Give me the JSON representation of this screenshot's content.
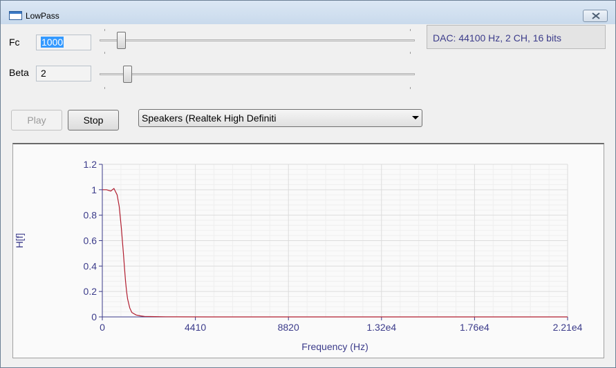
{
  "window": {
    "title": "LowPass"
  },
  "controls": {
    "fc": {
      "label": "Fc",
      "value": "1000",
      "slider_fraction": 0.05
    },
    "beta": {
      "label": "Beta",
      "value": "2",
      "slider_fraction": 0.07
    },
    "dac_status": "DAC: 44100 Hz, 2 CH, 16 bits",
    "play_label": "Play",
    "stop_label": "Stop",
    "device_selected": "Speakers (Realtek High Definiti"
  },
  "colors": {
    "curve": "#b01c2e",
    "axis_text": "#3b3b8a"
  },
  "chart_data": {
    "type": "line",
    "xlabel": "Frequency (Hz)",
    "ylabel": "H[f]",
    "xlim": [
      0,
      22050
    ],
    "ylim": [
      0,
      1.2
    ],
    "x_ticks": [
      0,
      4410,
      8820,
      13230,
      17640,
      22050
    ],
    "x_tick_labels": [
      "0",
      "4410",
      "8820",
      "1.32e4",
      "1.76e4",
      "2.21e4"
    ],
    "y_ticks": [
      0,
      0.2,
      0.4,
      0.6,
      0.8,
      1,
      1.2
    ],
    "y_tick_labels": [
      "0",
      "0.2",
      "0.4",
      "0.6",
      "0.8",
      "1",
      "1.2"
    ],
    "grid": true,
    "series": [
      {
        "x": [
          0,
          200,
          400,
          550,
          700,
          800,
          900,
          950,
          1000,
          1050,
          1100,
          1150,
          1200,
          1300,
          1400,
          1600,
          1800,
          2000,
          2500,
          3000,
          5000,
          10000,
          15000,
          22050
        ],
        "y": [
          1,
          1,
          0.99,
          1.01,
          0.96,
          0.87,
          0.7,
          0.6,
          0.5,
          0.39,
          0.28,
          0.2,
          0.14,
          0.07,
          0.035,
          0.015,
          0.008,
          0.004,
          0.002,
          0.001,
          0,
          0,
          0,
          0
        ]
      }
    ]
  }
}
